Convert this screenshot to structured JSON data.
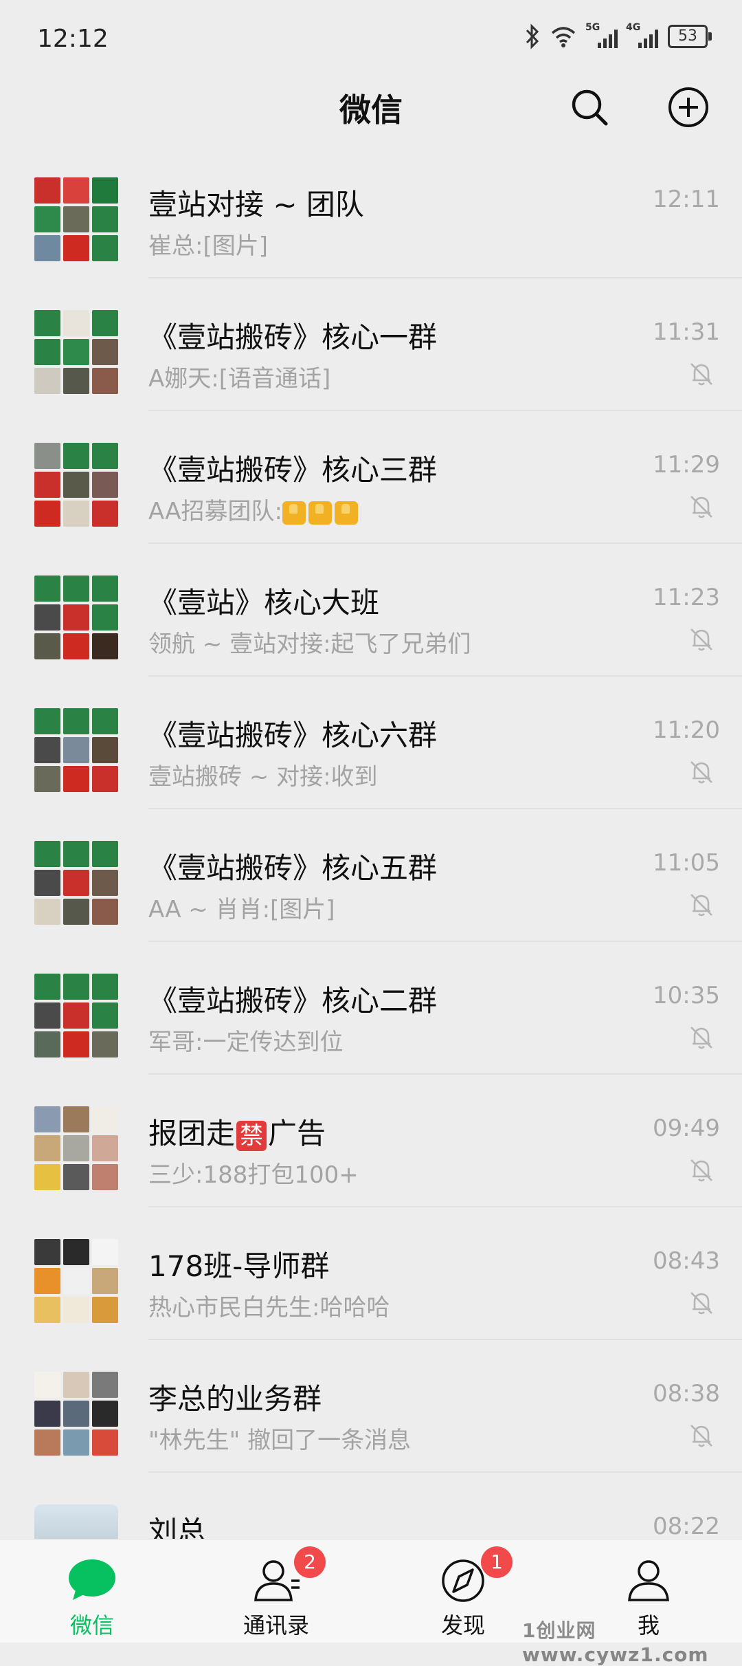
{
  "status_bar": {
    "time": "12:12",
    "battery": "53",
    "net1": "5G",
    "net2": "4G"
  },
  "header": {
    "title": "微信"
  },
  "chats": [
    {
      "name": "壹站对接 ~ 团队",
      "preview": "崔总:[图片]",
      "time": "12:11",
      "muted": false
    },
    {
      "name": "《壹站搬砖》核心一群",
      "preview": "A娜天:[语音通话]",
      "time": "11:31",
      "muted": true
    },
    {
      "name": "《壹站搬砖》核心三群",
      "preview": "AA招募团队:",
      "time": "11:29",
      "muted": true
    },
    {
      "name": "《壹站》核心大班",
      "preview": "领航 ~ 壹站对接:起飞了兄弟们",
      "time": "11:23",
      "muted": true
    },
    {
      "name": "《壹站搬砖》核心六群",
      "preview": "壹站搬砖 ~ 对接:收到",
      "time": "11:20",
      "muted": true
    },
    {
      "name": "《壹站搬砖》核心五群",
      "preview": "AA ~ 肖肖:[图片]",
      "time": "11:05",
      "muted": true
    },
    {
      "name": "《壹站搬砖》核心二群",
      "preview": "军哥:一定传达到位",
      "time": "10:35",
      "muted": true
    },
    {
      "name_before": "报团走",
      "name_ban": "禁",
      "name_after": "广告",
      "preview": "三少:188打包100+",
      "time": "09:49",
      "muted": true
    },
    {
      "name": "178班-导师群",
      "preview": "热心市民白先生:哈哈哈",
      "time": "08:43",
      "muted": true
    },
    {
      "name": "李总的业务群",
      "preview": "\"林先生\" 撤回了一条消息",
      "time": "08:38",
      "muted": true
    },
    {
      "name": "刘总",
      "preview": "",
      "time": "08:22",
      "muted": false
    }
  ],
  "tabs": [
    {
      "label": "微信",
      "icon": "chat-bubble-icon",
      "badge": ""
    },
    {
      "label": "通讯录",
      "icon": "contacts-icon",
      "badge": "2"
    },
    {
      "label": "发现",
      "icon": "compass-icon",
      "badge": "1"
    },
    {
      "label": "我",
      "icon": "person-icon",
      "badge": ""
    }
  ],
  "watermark": "1创业网www.cywz1.com",
  "colors": {
    "accent": "#07c160",
    "badge": "#f24a4a",
    "background": "#ededed"
  }
}
